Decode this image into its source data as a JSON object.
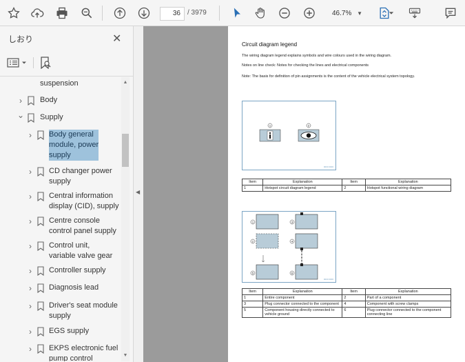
{
  "toolbar": {
    "page_current": "36",
    "page_total": "/ 3979",
    "zoom": "46.7%"
  },
  "sidebar": {
    "title": "しおり",
    "items": [
      {
        "label_lines": [
          "suspension"
        ],
        "chev": "",
        "selected": false
      },
      {
        "label_lines": [
          "Body"
        ],
        "chev": ">",
        "selected": false
      },
      {
        "label_lines": [
          "Supply"
        ],
        "chev": "v",
        "selected": false
      },
      {
        "label_lines": [
          "Body general",
          "module, power",
          "supply"
        ],
        "chev": ">",
        "selected": true
      },
      {
        "label_lines": [
          "CD changer power",
          "supply"
        ],
        "chev": ">",
        "selected": false
      },
      {
        "label_lines": [
          "Central information",
          "display (CID), supply"
        ],
        "chev": ">",
        "selected": false
      },
      {
        "label_lines": [
          "Centre console",
          "control panel supply"
        ],
        "chev": ">",
        "selected": false
      },
      {
        "label_lines": [
          "Control unit,",
          "variable valve gear"
        ],
        "chev": ">",
        "selected": false
      },
      {
        "label_lines": [
          "Controller supply"
        ],
        "chev": ">",
        "selected": false
      },
      {
        "label_lines": [
          "Diagnosis lead"
        ],
        "chev": ">",
        "selected": false
      },
      {
        "label_lines": [
          "Driver's seat module",
          "supply"
        ],
        "chev": ">",
        "selected": false
      },
      {
        "label_lines": [
          "EGS supply"
        ],
        "chev": ">",
        "selected": false
      },
      {
        "label_lines": [
          "EKPS electronic fuel",
          "pump control"
        ],
        "chev": ">",
        "selected": false
      }
    ]
  },
  "document": {
    "title": "Circuit diagram legend",
    "para1": "The wiring diagram legend explains symbols and wire colours used in the wiring diagram.",
    "para2": "Notes on line check: Notes for checking the lines and electrical components",
    "para3": "Note: The basis for definition of pin assignments is the content of the vehicle electrical system topology.",
    "fig1_code": "0000 0000",
    "fig1_callouts": [
      "1",
      "2"
    ],
    "table1": {
      "headers": [
        "Item",
        "Explanation",
        "Item",
        "Explanation"
      ],
      "rows": [
        [
          "1",
          "Hotspot circuit diagram legend",
          "2",
          "Hotspot functional wiring diagram"
        ]
      ]
    },
    "fig2_code": "0000 0000",
    "fig2_callouts": [
      "1",
      "2",
      "3",
      "4",
      "5",
      "6"
    ],
    "table2": {
      "headers": [
        "Item",
        "Explanation",
        "Item",
        "Explanation"
      ],
      "rows": [
        [
          "1",
          "Entire component",
          "2",
          "Part of a component"
        ],
        [
          "3",
          "Plug connector connected to the component",
          "4",
          "Component with screw clamps"
        ],
        [
          "5",
          "Component housing directly connected to vehicle ground",
          "6",
          "Plug connector connected to the component connecting line"
        ]
      ]
    }
  }
}
